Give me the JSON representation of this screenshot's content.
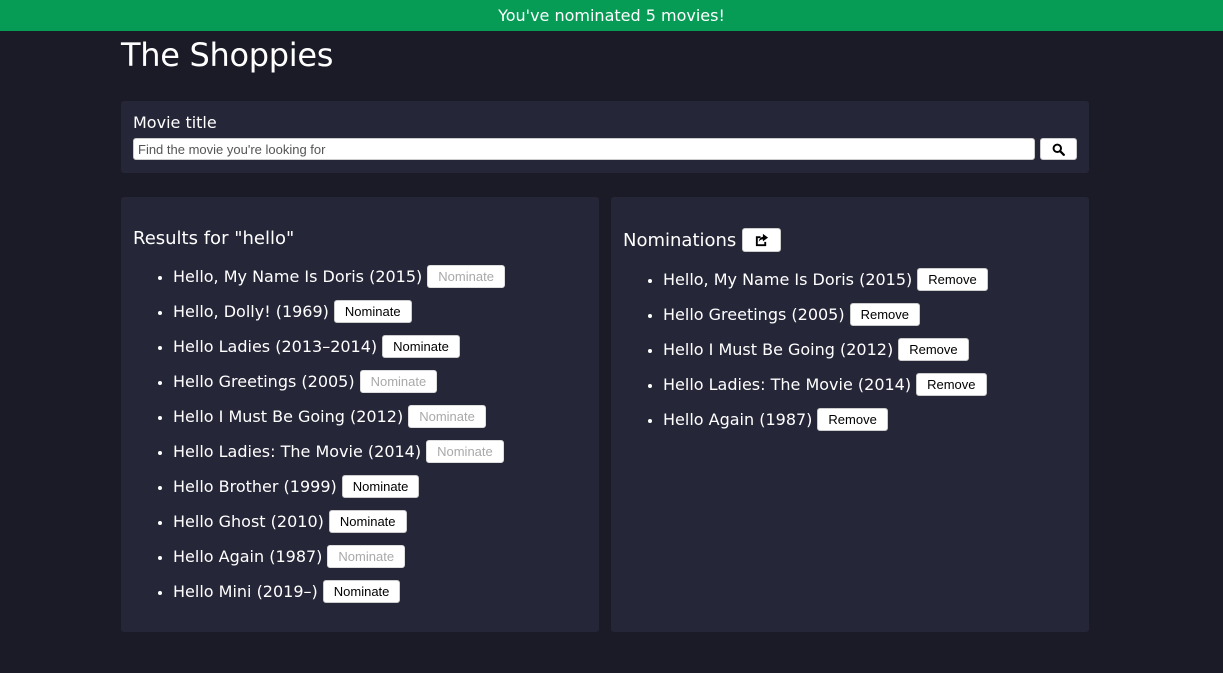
{
  "banner": {
    "text": "You've nominated 5 movies!"
  },
  "header": {
    "title": "The Shoppies"
  },
  "search": {
    "label": "Movie title",
    "placeholder": "Find the movie you're looking for",
    "value": "",
    "button_icon": "search-icon"
  },
  "results": {
    "heading": "Results for \"hello\"",
    "items": [
      {
        "title": "Hello, My Name Is Doris (2015)",
        "button": "Nominate",
        "disabled": true
      },
      {
        "title": "Hello, Dolly! (1969)",
        "button": "Nominate",
        "disabled": false
      },
      {
        "title": "Hello Ladies (2013–2014)",
        "button": "Nominate",
        "disabled": false
      },
      {
        "title": "Hello Greetings (2005)",
        "button": "Nominate",
        "disabled": true
      },
      {
        "title": "Hello I Must Be Going (2012)",
        "button": "Nominate",
        "disabled": true
      },
      {
        "title": "Hello Ladies: The Movie (2014)",
        "button": "Nominate",
        "disabled": true
      },
      {
        "title": "Hello Brother (1999)",
        "button": "Nominate",
        "disabled": false
      },
      {
        "title": "Hello Ghost (2010)",
        "button": "Nominate",
        "disabled": false
      },
      {
        "title": "Hello Again (1987)",
        "button": "Nominate",
        "disabled": true
      },
      {
        "title": "Hello Mini (2019–)",
        "button": "Nominate",
        "disabled": false
      }
    ]
  },
  "nominations": {
    "heading": "Nominations",
    "share_icon": "share-icon",
    "items": [
      {
        "title": "Hello, My Name Is Doris (2015)",
        "button": "Remove"
      },
      {
        "title": "Hello Greetings (2005)",
        "button": "Remove"
      },
      {
        "title": "Hello I Must Be Going (2012)",
        "button": "Remove"
      },
      {
        "title": "Hello Ladies: The Movie (2014)",
        "button": "Remove"
      },
      {
        "title": "Hello Again (1987)",
        "button": "Remove"
      }
    ]
  },
  "colors": {
    "banner": "#069c56",
    "background": "#1b1b27",
    "panel": "#252638"
  }
}
